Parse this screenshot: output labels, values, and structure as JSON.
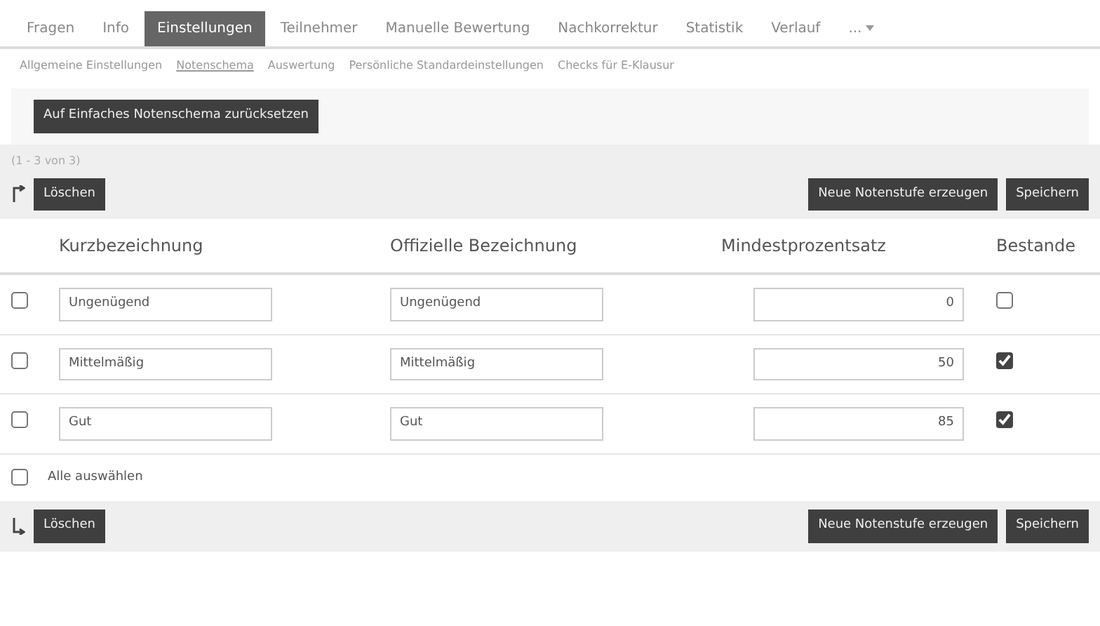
{
  "tabs": [
    {
      "label": "Fragen",
      "selected": false
    },
    {
      "label": "Info",
      "selected": false
    },
    {
      "label": "Einstellungen",
      "selected": true
    },
    {
      "label": "Teilnehmer",
      "selected": false
    },
    {
      "label": "Manuelle Bewertung",
      "selected": false
    },
    {
      "label": "Nachkorrektur",
      "selected": false
    },
    {
      "label": "Statistik",
      "selected": false
    },
    {
      "label": "Verlauf",
      "selected": false
    },
    {
      "label": "...",
      "selected": false
    }
  ],
  "subtabs": [
    {
      "label": "Allgemeine Einstellungen",
      "selected": false
    },
    {
      "label": "Notenschema",
      "selected": true
    },
    {
      "label": "Auswertung",
      "selected": false
    },
    {
      "label": "Persönliche Standardeinstellungen",
      "selected": false
    },
    {
      "label": "Checks für E-Klausur",
      "selected": false
    }
  ],
  "reset_button": "Auf Einfaches Notenschema zurücksetzen",
  "count": "(1 - 3 von 3)",
  "top_actions": {
    "delete": "Löschen",
    "create": "Neue Notenstufe erzeugen",
    "save": "Speichern"
  },
  "columns": [
    "Kurzbezeichnung",
    "Offizielle Bezeichnung",
    "Mindestprozentsatz",
    "Bestande"
  ],
  "rows": [
    {
      "selected": false,
      "short": "Ungenügend",
      "official": "Ungenügend",
      "percent": "0",
      "passed": false
    },
    {
      "selected": false,
      "short": "Mittelmäßig",
      "official": "Mittelmäßig",
      "percent": "50",
      "passed": true
    },
    {
      "selected": false,
      "short": "Gut",
      "official": "Gut",
      "percent": "85",
      "passed": true
    }
  ],
  "select_all": {
    "label": "Alle auswählen",
    "checked": false
  },
  "bottom_actions": {
    "delete": "Löschen",
    "create": "Neue Notenstufe erzeugen",
    "save": "Speichern"
  }
}
